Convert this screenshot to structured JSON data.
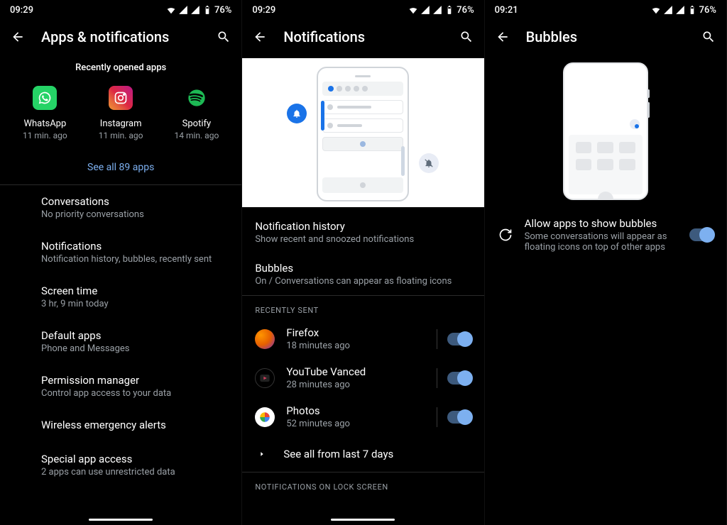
{
  "statusbar": {
    "time1": "09:29",
    "time2": "09:29",
    "time3": "09:21",
    "battery": "76%"
  },
  "screen1": {
    "title": "Apps & notifications",
    "recent_label": "Recently opened apps",
    "apps": [
      {
        "name": "WhatsApp",
        "sub": "11 min. ago"
      },
      {
        "name": "Instagram",
        "sub": "11 min. ago"
      },
      {
        "name": "Spotify",
        "sub": "14 min. ago"
      }
    ],
    "see_all": "See all 89 apps",
    "items": [
      {
        "title": "Conversations",
        "sub": "No priority conversations"
      },
      {
        "title": "Notifications",
        "sub": "Notification history, bubbles, recently sent"
      },
      {
        "title": "Screen time",
        "sub": "3 hr, 9 min today"
      },
      {
        "title": "Default apps",
        "sub": "Phone and Messages"
      },
      {
        "title": "Permission manager",
        "sub": "Control app access to your data"
      },
      {
        "title": "Wireless emergency alerts",
        "sub": ""
      },
      {
        "title": "Special app access",
        "sub": "2 apps can use unrestricted data"
      }
    ]
  },
  "screen2": {
    "title": "Notifications",
    "items": [
      {
        "title": "Notification history",
        "sub": "Show recent and snoozed notifications"
      },
      {
        "title": "Bubbles",
        "sub": "On / Conversations can appear as floating icons"
      }
    ],
    "recent_header": "RECENTLY SENT",
    "recent": [
      {
        "name": "Firefox",
        "sub": "18 minutes ago"
      },
      {
        "name": "YouTube Vanced",
        "sub": "28 minutes ago"
      },
      {
        "name": "Photos",
        "sub": "52 minutes ago"
      }
    ],
    "see_all": "See all from last 7 days",
    "lock_header": "NOTIFICATIONS ON LOCK SCREEN"
  },
  "screen3": {
    "title": "Bubbles",
    "row": {
      "title": "Allow apps to show bubbles",
      "sub": "Some conversations will appear as floating icons on top of other apps"
    }
  }
}
